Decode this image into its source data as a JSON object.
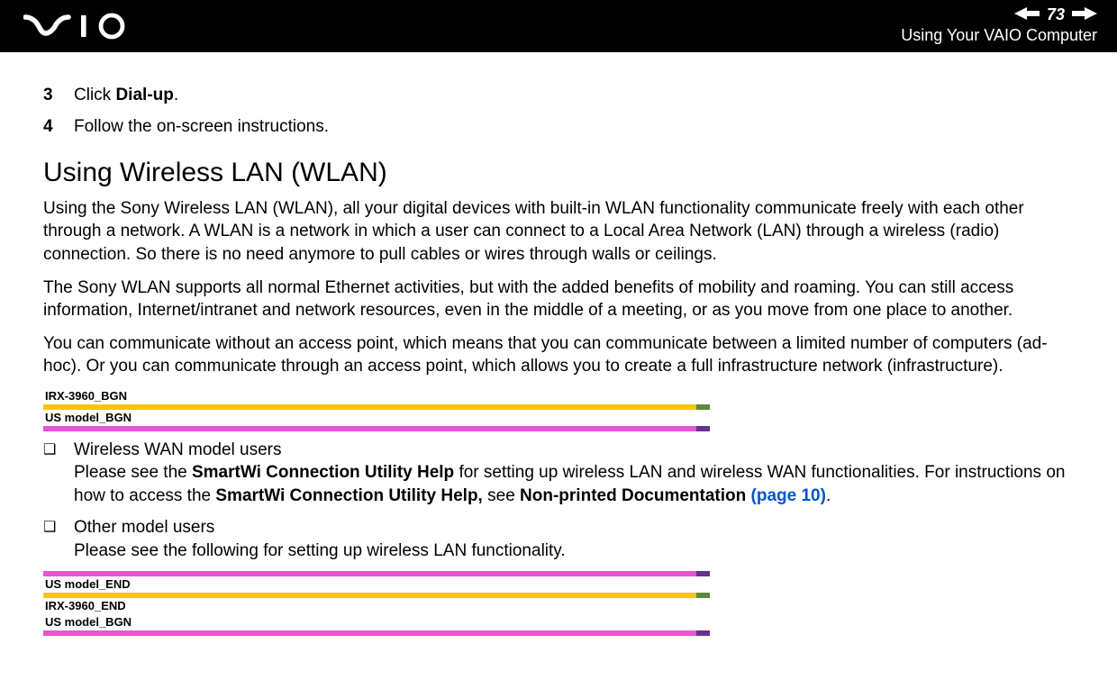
{
  "header": {
    "page_number": "73",
    "title": "Using Your VAIO Computer"
  },
  "steps": [
    {
      "num": "3",
      "text_before": "Click ",
      "bold": "Dial-up",
      "text_after": "."
    },
    {
      "num": "4",
      "text_before": "Follow the on-screen instructions.",
      "bold": "",
      "text_after": ""
    }
  ],
  "section_heading": "Using Wireless LAN (WLAN)",
  "paragraphs": [
    "Using the Sony Wireless LAN (WLAN), all your digital devices with built-in WLAN functionality communicate freely with each other through a network. A WLAN is a network in which a user can connect to a Local Area Network (LAN) through a wireless (radio) connection. So there is no need anymore to pull cables or wires through walls or ceilings.",
    "The Sony WLAN supports all normal Ethernet activities, but with the added benefits of mobility and roaming. You can still access information, Internet/intranet and network resources, even in the middle of a meeting, or as you move from one place to another.",
    "You can communicate without an access point, which means that you can communicate between a limited number of computers (ad-hoc). Or you can communicate through an access point, which allows you to create a full infrastructure network (infrastructure)."
  ],
  "tags_top": [
    "IRX-3960_BGN",
    "US model_BGN"
  ],
  "bullets": [
    {
      "title": "Wireless WAN model users",
      "body_pre": "Please see the ",
      "bold1": "SmartWi Connection Utility Help",
      "body_mid1": " for setting up wireless LAN and wireless WAN functionalities. For instructions on how to access the ",
      "bold2": "SmartWi Connection Utility Help,",
      "body_mid2": " see ",
      "bold3": "Non-printed Documentation ",
      "link": "(page 10)",
      "body_end": "."
    },
    {
      "title": "Other model users",
      "body_pre": "Please see the following for setting up wireless LAN functionality.",
      "bold1": "",
      "body_mid1": "",
      "bold2": "",
      "body_mid2": "",
      "bold3": "",
      "link": "",
      "body_end": ""
    }
  ],
  "tags_bottom": [
    "US model_END",
    "IRX-3960_END",
    "US model_BGN"
  ]
}
